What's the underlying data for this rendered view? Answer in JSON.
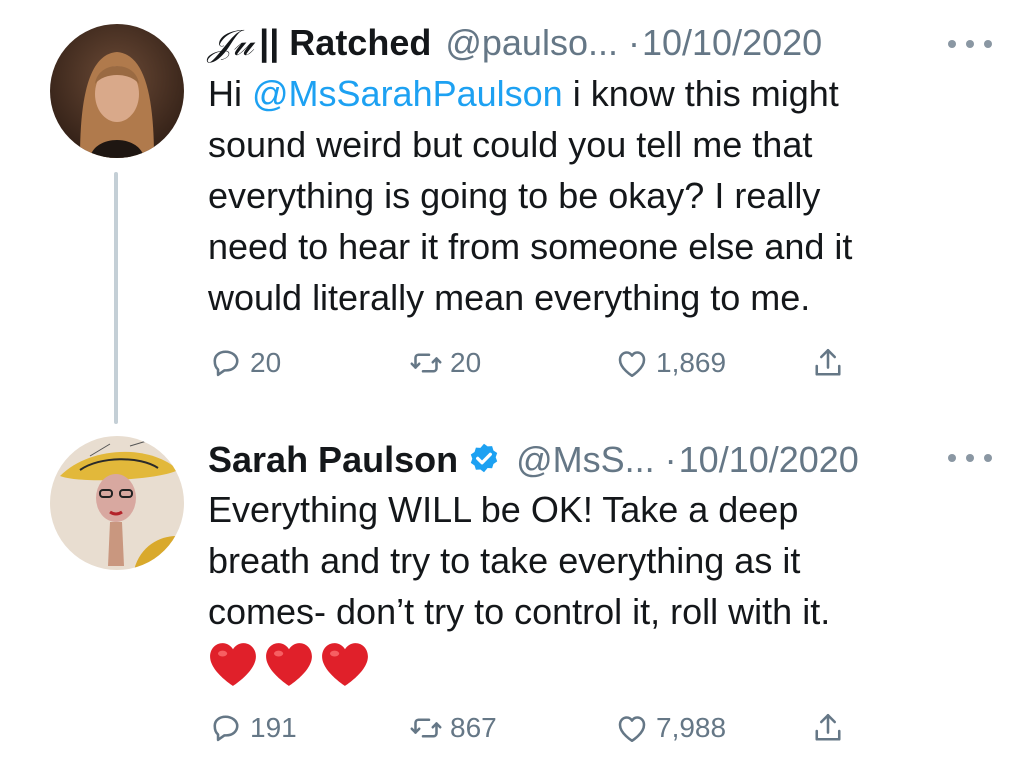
{
  "tweets": [
    {
      "display_name": "|| Ratched",
      "display_name_prefix": "𝒥𝓊",
      "handle": "@paulso...",
      "dot": "·",
      "date": "10/10/2020",
      "text_before_mention": "Hi ",
      "mention": "@MsSarahPaulson",
      "text_lines": [
        " i know this might",
        "sound weird but could you tell me that",
        "everything is going to be okay? I really",
        "need to hear it from someone else and it",
        "would literally mean everything to me."
      ],
      "replies": "20",
      "retweets": "20",
      "likes": "1,869"
    },
    {
      "display_name": "Sarah Paulson",
      "verified": true,
      "handle": "@MsS...",
      "dot": "·",
      "date": "10/10/2020",
      "text_lines": [
        "Everything WILL be OK! Take a deep",
        "breath and try to take everything as it",
        "comes- don’t try to control it, roll with it."
      ],
      "emoji": [
        "❤️",
        "❤️",
        "❤️"
      ],
      "replies": "191",
      "retweets": "867",
      "likes": "7,988"
    }
  ],
  "colors": {
    "link": "#1da1f2",
    "muted": "#657786",
    "thread_line": "#c4cfd6",
    "text": "#14171a",
    "heart": "#e0202a"
  },
  "icons": [
    "reply-icon",
    "retweet-icon",
    "like-icon",
    "share-icon",
    "more-icon",
    "verified-badge-icon"
  ]
}
